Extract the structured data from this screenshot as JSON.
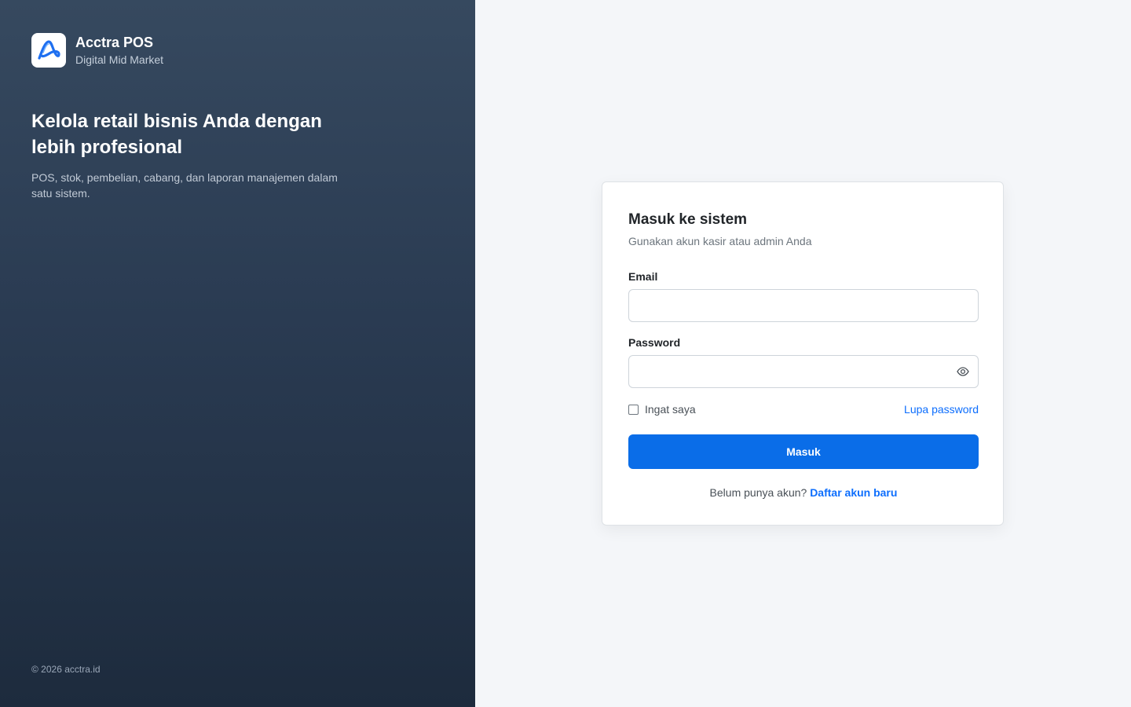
{
  "brand": {
    "name": "Acctra POS",
    "tagline": "Digital Mid Market",
    "logo_icon": "acctra-logo-icon",
    "logo_color": "#1e6ff0"
  },
  "hero": {
    "title": "Kelola retail bisnis Anda dengan lebih profesional",
    "subtitle": "POS, stok, pembelian, cabang, dan laporan manajemen dalam satu sistem."
  },
  "footer": {
    "copyright": "© 2026 acctra.id"
  },
  "login": {
    "title": "Masuk ke sistem",
    "subtitle": "Gunakan akun kasir atau admin Anda",
    "email_label": "Email",
    "email_value": "",
    "password_label": "Password",
    "password_value": "",
    "password_toggle_icon": "eye-icon",
    "remember_label": "Ingat saya",
    "remember_checked": false,
    "forgot_link": "Lupa password",
    "submit_label": "Masuk",
    "signup_prompt": "Belum punya akun?",
    "signup_link": "Daftar akun baru"
  },
  "colors": {
    "primary": "#0a6de8",
    "link": "#0d6efd",
    "panel_top": "#36495f",
    "panel_bottom": "#1d2b3d",
    "page_bg": "#f4f6f9"
  }
}
